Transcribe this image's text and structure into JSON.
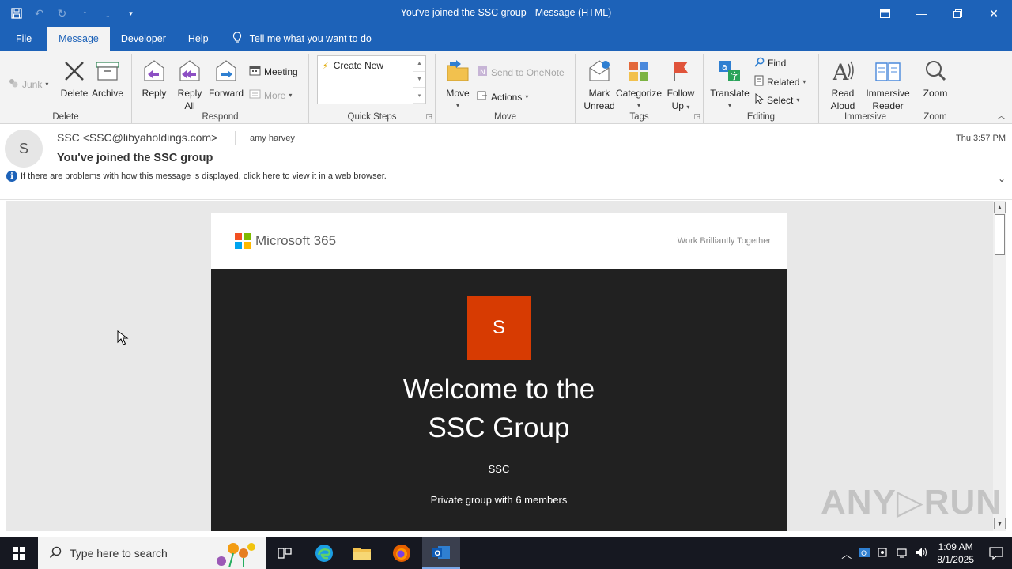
{
  "window": {
    "title": "You've joined the SSC group  -  Message (HTML)"
  },
  "tabs": [
    {
      "label": "File"
    },
    {
      "label": "Message"
    },
    {
      "label": "Developer"
    },
    {
      "label": "Help"
    }
  ],
  "tellme": "Tell me what you want to do",
  "ribbon": {
    "delete_group": {
      "label": "Delete",
      "junk": "Junk",
      "delete": "Delete",
      "archive": "Archive"
    },
    "respond_group": {
      "label": "Respond",
      "reply": "Reply",
      "reply_all_1": "Reply",
      "reply_all_2": "All",
      "forward": "Forward",
      "meeting": "Meeting",
      "more": "More"
    },
    "quicksteps_group": {
      "label": "Quick Steps",
      "create_new": "Create New"
    },
    "move_group": {
      "label": "Move",
      "move": "Move",
      "onenote": "Send to OneNote",
      "actions": "Actions"
    },
    "tags_group": {
      "label": "Tags",
      "mark_1": "Mark",
      "mark_2": "Unread",
      "categorize": "Categorize",
      "follow_1": "Follow",
      "follow_2": "Up"
    },
    "editing_group": {
      "label": "Editing",
      "translate": "Translate",
      "find": "Find",
      "related": "Related",
      "select": "Select"
    },
    "immersive_group": {
      "label": "Immersive",
      "read_1": "Read",
      "read_2": "Aloud",
      "reader_1": "Immersive",
      "reader_2": "Reader"
    },
    "zoom_group": {
      "label": "Zoom",
      "zoom": "Zoom"
    }
  },
  "message": {
    "avatar_letter": "S",
    "sender": "SSC <SSC@libyaholdings.com>",
    "recipient": "amy harvey",
    "datetime": "Thu 3:57 PM",
    "subject": "You've joined the SSC group",
    "info": "If there are problems with how this message is displayed, click here to view it in a web browser."
  },
  "email": {
    "brand": "Microsoft 365",
    "tagline": "Work Brilliantly Together",
    "group_letter": "S",
    "welcome_1": "Welcome to the",
    "welcome_2": "SSC Group",
    "group_name": "SSC",
    "members": "Private group with 6 members"
  },
  "taskbar": {
    "search_placeholder": "Type here to search",
    "time": "1:09 AM",
    "date": "8/1/2025"
  },
  "colors": {
    "accent": "#1d62b8",
    "group_avatar": "#d73b02",
    "dark_panel": "#212121"
  }
}
